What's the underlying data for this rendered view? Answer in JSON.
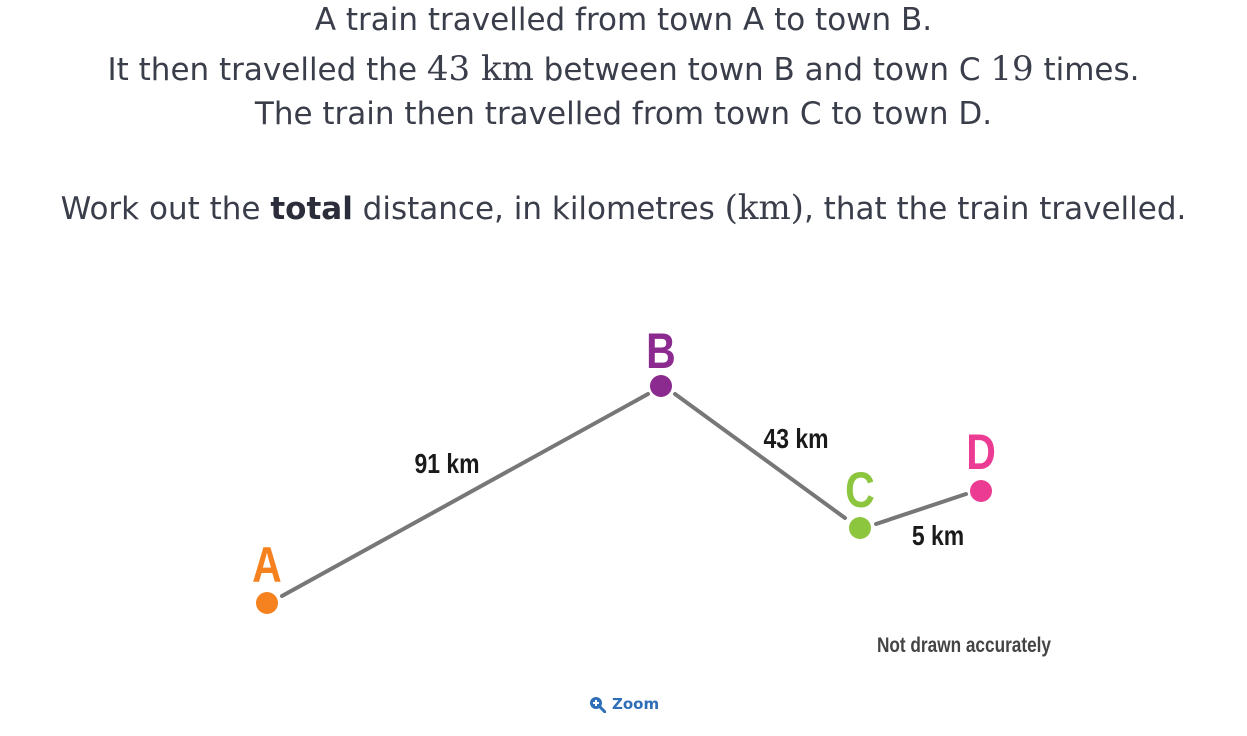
{
  "question": {
    "line1": "A train travelled from town A to town B.",
    "line2": {
      "before": "It then travelled the ",
      "distance_math": "43 km",
      "middle": " between town B and town C ",
      "times_math": "19",
      "after": " times."
    },
    "line3": "The train then travelled from town C to town D.",
    "line4": {
      "before": "Work out the ",
      "bold": "total",
      "middle": " distance, in kilometres ",
      "unit_math": "(km)",
      "after": ", that the train travelled."
    }
  },
  "diagram": {
    "towns": [
      {
        "label": "A",
        "color": "#f5821f"
      },
      {
        "label": "B",
        "color": "#8b2a8f"
      },
      {
        "label": "C",
        "color": "#8cc63f"
      },
      {
        "label": "D",
        "color": "#ec3b93"
      }
    ],
    "segments": [
      {
        "from": "A",
        "to": "B",
        "label": "91 km"
      },
      {
        "from": "B",
        "to": "C",
        "label": "43 km"
      },
      {
        "from": "C",
        "to": "D",
        "label": "5 km"
      }
    ],
    "line_color": "#777777",
    "note": "Not drawn accurately"
  },
  "zoom": {
    "label": "Zoom",
    "icon": "zoom-in-icon",
    "color": "#2f6fb8"
  }
}
